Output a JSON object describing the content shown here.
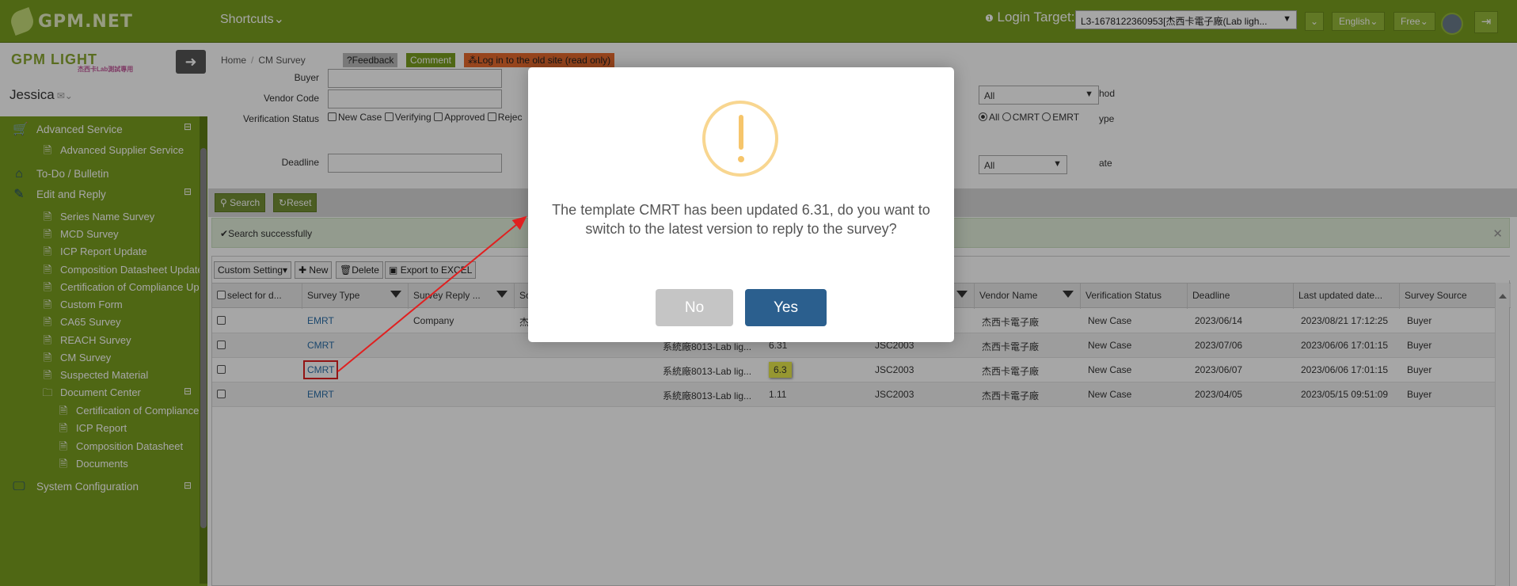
{
  "topbar": {
    "brand": "GPM.NET",
    "shortcuts": "Shortcuts",
    "login_target_label": "Login Target:",
    "login_target_value": "L3-1678122360953[杰西卡電子廠(Lab ligh...",
    "language": "English",
    "plan": "Free"
  },
  "sidebar": {
    "logo_text": "GPM LIGHT",
    "logo_sub": "杰西卡Lab測試專用",
    "user": "Jessica",
    "items": [
      {
        "label": "Advanced Service",
        "level": 0,
        "icon": "cart-icon",
        "toggle": "⊟"
      },
      {
        "label": "Advanced Supplier Service",
        "level": 1,
        "icon": "file-icon"
      },
      {
        "label": "To-Do / Bulletin",
        "level": 0,
        "icon": "home-icon"
      },
      {
        "label": "Edit and Reply",
        "level": 0,
        "icon": "edit-icon",
        "toggle": "⊟"
      },
      {
        "label": "Series Name Survey",
        "level": 1,
        "icon": "file-icon"
      },
      {
        "label": "MCD Survey",
        "level": 1,
        "icon": "file-icon"
      },
      {
        "label": "ICP Report Update",
        "level": 1,
        "icon": "file-icon"
      },
      {
        "label": "Composition Datasheet Update",
        "level": 1,
        "icon": "file-icon"
      },
      {
        "label": "Certification of Compliance Upd",
        "level": 1,
        "icon": "file-icon"
      },
      {
        "label": "Custom Form",
        "level": 1,
        "icon": "file-icon"
      },
      {
        "label": "CA65 Survey",
        "level": 1,
        "icon": "file-icon"
      },
      {
        "label": "REACH Survey",
        "level": 1,
        "icon": "file-icon"
      },
      {
        "label": "CM Survey",
        "level": 1,
        "icon": "file-icon"
      },
      {
        "label": "Suspected Material",
        "level": 1,
        "icon": "file-icon"
      },
      {
        "label": "Document Center",
        "level": 1,
        "icon": "folder-icon",
        "toggle": "⊟"
      },
      {
        "label": "Certification of Compliance",
        "level": 2,
        "icon": "file-icon"
      },
      {
        "label": "ICP Report",
        "level": 2,
        "icon": "file-icon"
      },
      {
        "label": "Composition Datasheet",
        "level": 2,
        "icon": "file-icon"
      },
      {
        "label": "Documents",
        "level": 2,
        "icon": "file-icon"
      },
      {
        "label": "System Configuration",
        "level": 0,
        "icon": "monitor-icon",
        "toggle": "⊟"
      }
    ]
  },
  "breadcrumb": {
    "home": "Home",
    "current": "CM Survey"
  },
  "badges": {
    "feedback": "?Feedback",
    "comment": "Comment",
    "old_site": "Log in to the old site (read only)"
  },
  "filters": {
    "buyer": "Buyer",
    "vendor_code": "Vendor Code",
    "verification_status": "Verification Status",
    "deadline": "Deadline",
    "status_options": [
      "New Case",
      "Verifying",
      "Approved",
      "Rejec"
    ],
    "method_label": "hod",
    "method_value": "All",
    "type_label": "ype",
    "type_options": [
      "All",
      "CMRT",
      "EMRT"
    ],
    "date_label": "ate",
    "date_value": "All"
  },
  "buttons": {
    "search": "Search",
    "reset": "Reset"
  },
  "message": "Search successfully",
  "grid_toolbar": {
    "custom": "Custom Setting",
    "new": "New",
    "delete": "Delete",
    "export": "Export to EXCEL"
  },
  "columns": [
    "select for d...",
    "Survey Type",
    "Survey Reply ...",
    "So",
    "",
    "",
    "",
    "Vendor Name",
    "Verification Status",
    "Deadline",
    "Last updated date...",
    "Survey Source"
  ],
  "rows": [
    {
      "type": "EMRT",
      "reply": "Company",
      "src": "杰",
      "item": "",
      "ver": "",
      "code": "",
      "vendor": "杰西卡電子廠",
      "status": "New Case",
      "deadline": "2023/06/14",
      "updated": "2023/08/21 17:12:25",
      "source": "Buyer"
    },
    {
      "type": "CMRT",
      "reply": "",
      "src": "",
      "item": "系統廠8013-Lab lig...",
      "ver": "6.31",
      "code": "JSC2003",
      "vendor": "杰西卡電子廠",
      "status": "New Case",
      "deadline": "2023/07/06",
      "updated": "2023/06/06 17:01:15",
      "source": "Buyer"
    },
    {
      "type": "CMRT",
      "reply": "",
      "src": "",
      "item": "系統廠8013-Lab lig...",
      "ver": "6.3",
      "code": "JSC2003",
      "vendor": "杰西卡電子廠",
      "status": "New Case",
      "deadline": "2023/06/07",
      "updated": "2023/06/06 17:01:15",
      "source": "Buyer"
    },
    {
      "type": "EMRT",
      "reply": "",
      "src": "",
      "item": "系統廠8013-Lab lig...",
      "ver": "1.11",
      "code": "JSC2003",
      "vendor": "杰西卡電子廠",
      "status": "New Case",
      "deadline": "2023/04/05",
      "updated": "2023/05/15 09:51:09",
      "source": "Buyer"
    }
  ],
  "dialog": {
    "message": "The template CMRT has been updated 6.31, do you want to switch to the latest version to reply to the survey?",
    "no": "No",
    "yes": "Yes"
  },
  "colors": {
    "brand": "#7a9e1f",
    "dialog_yes": "#2b5f8e",
    "dialog_no": "#c5c5c5",
    "warning": "#f6c56b",
    "annotation": "#e02020"
  }
}
